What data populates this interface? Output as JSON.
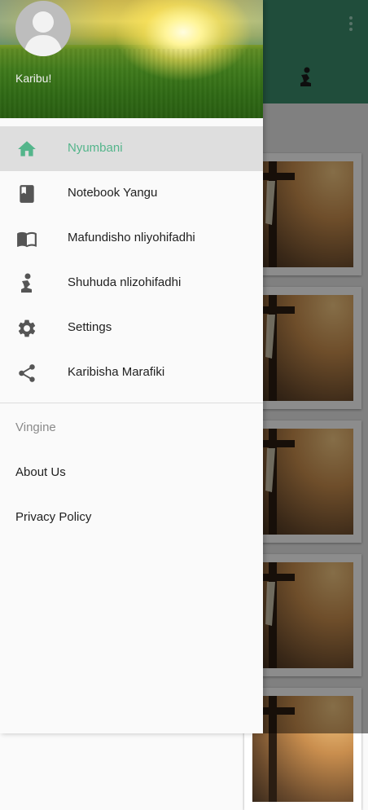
{
  "drawer": {
    "welcome_text": "Karibu!",
    "items": [
      {
        "label": "Nyumbani",
        "icon": "home-icon",
        "active": true
      },
      {
        "label": "Notebook Yangu",
        "icon": "notebook-icon"
      },
      {
        "label": "Mafundisho nliyohifadhi",
        "icon": "book-open-icon"
      },
      {
        "label": "Shuhuda nlizohifadhi",
        "icon": "praying-person-icon"
      },
      {
        "label": "Settings",
        "icon": "gear-icon"
      },
      {
        "label": "Karibisha Marafiki",
        "icon": "share-icon"
      }
    ],
    "section_title": "Vingine",
    "other_items": [
      {
        "label": "About Us"
      },
      {
        "label": "Privacy Policy"
      }
    ]
  },
  "colors": {
    "accent": "#54b58b",
    "appbar": "#3b8d6c"
  }
}
